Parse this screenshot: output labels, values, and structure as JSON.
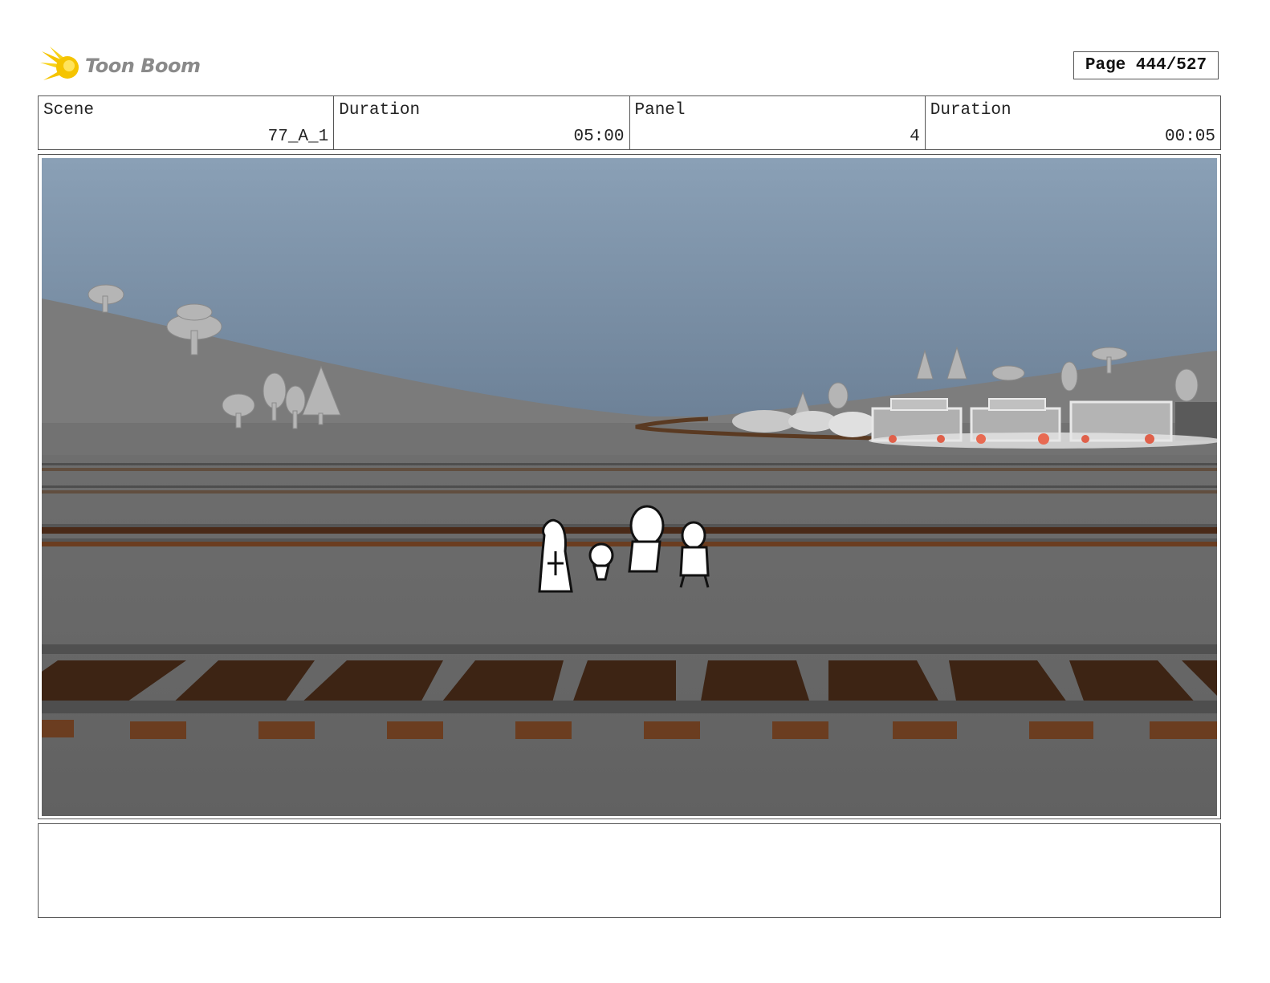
{
  "header": {
    "brand": "Toon Boom",
    "page": "Page 444/527"
  },
  "info": {
    "scene_label": "Scene",
    "scene_value": "77_A_1",
    "duration_label": "Duration",
    "duration_value": "05:00",
    "panel_label": "Panel",
    "panel_value": "4",
    "panel_duration_label": "Duration",
    "panel_duration_value": "00:05"
  },
  "notes": {
    "text": ""
  },
  "colors": {
    "sky_top": "#8aa0b6",
    "sky_bottom": "#6f8399",
    "ground": "#666666",
    "hill": "#7a7a7a",
    "tie": "#4a2a18",
    "rail": "#5a5a5a",
    "logo_yellow": "#f5c400"
  }
}
